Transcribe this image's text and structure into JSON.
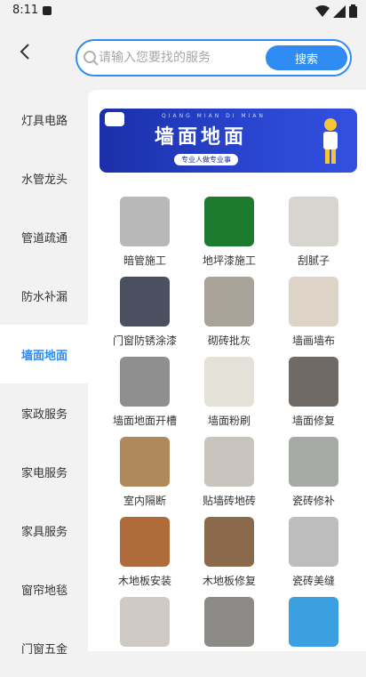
{
  "status": {
    "time": "8:11"
  },
  "search": {
    "placeholder": "请输入您要找的服务",
    "button_label": "搜索"
  },
  "sidebar": {
    "items": [
      {
        "label": "灯具电路"
      },
      {
        "label": "水管龙头"
      },
      {
        "label": "管道疏通"
      },
      {
        "label": "防水补漏"
      },
      {
        "label": "墙面地面"
      },
      {
        "label": "家政服务"
      },
      {
        "label": "家电服务"
      },
      {
        "label": "家具服务"
      },
      {
        "label": "窗帘地毯"
      },
      {
        "label": "门窗五金"
      }
    ],
    "active_label": "墙面地面"
  },
  "banner": {
    "title": "墙面地面",
    "pinyin": "QIANG MIAN DI MIAN",
    "tagline": "专业人做专业事"
  },
  "services": [
    {
      "label": "暗管施工",
      "color": "#b8b8b8"
    },
    {
      "label": "地坪漆施工",
      "color": "#1d7a2e"
    },
    {
      "label": "刮腻子",
      "color": "#d8d4cf"
    },
    {
      "label": "门窗防锈涂漆",
      "color": "#4a5060"
    },
    {
      "label": "砌砖批灰",
      "color": "#a9a39a"
    },
    {
      "label": "墙画墙布",
      "color": "#ddd3c7"
    },
    {
      "label": "墙面地面开槽",
      "color": "#8f8f8f"
    },
    {
      "label": "墙面粉刷",
      "color": "#e4e1d9"
    },
    {
      "label": "墙面修复",
      "color": "#6f6a66"
    },
    {
      "label": "室内隔断",
      "color": "#b0895a"
    },
    {
      "label": "贴墙砖地砖",
      "color": "#c9c4be"
    },
    {
      "label": "瓷砖修补",
      "color": "#a6aaa4"
    },
    {
      "label": "木地板安装",
      "color": "#b06b3a"
    },
    {
      "label": "木地板修复",
      "color": "#8a6a4a"
    },
    {
      "label": "瓷砖美缝",
      "color": "#bdbdbd"
    },
    {
      "label": "",
      "color": "#cfcac3"
    },
    {
      "label": "",
      "color": "#8c8a86"
    },
    {
      "label": "",
      "color": "#3aa0e0"
    }
  ],
  "colors": {
    "accent": "#2f8cf3"
  }
}
